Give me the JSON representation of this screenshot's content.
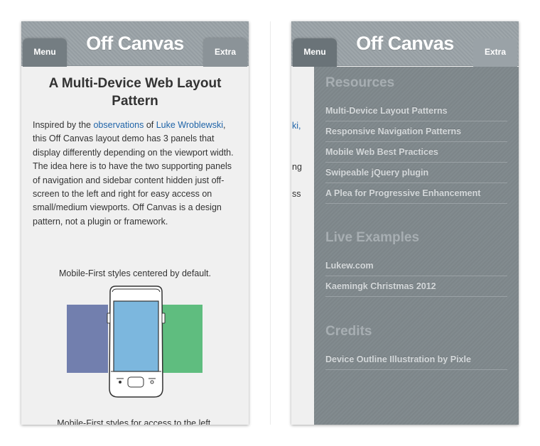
{
  "left_view": {
    "header": {
      "title": "Off Canvas",
      "menu_tab": "Menu",
      "extra_tab": "Extra"
    },
    "heading": "A Multi-Device Web Layout Pattern",
    "intro": {
      "p1": "Inspired by the ",
      "link1": "observations",
      "p2": " of ",
      "link2": "Luke Wroblewski",
      "p3": ", this Off Canvas layout demo has 3 panels that display differently depending on the viewport width. The idea here is to have the two supporting panels of navigation and sidebar content hidden just off-screen to the left and right for easy access on small/medium viewports. Off Canvas is a design pattern, not a plugin or framework."
    },
    "caption_1": "Mobile-First styles centered by default.",
    "caption_2": "Mobile-First styles for access to the left.",
    "colors": {
      "left_panel": "#727fae",
      "center_panel": "#7cb7de",
      "right_panel": "#5fbd7f",
      "link": "#1f64a8"
    }
  },
  "right_view": {
    "header": {
      "title": "Off Canvas",
      "menu_tab": "Menu",
      "extra_tab": "Extra"
    },
    "peek_lines": [
      "ki,",
      "ng",
      "ss"
    ],
    "sections": [
      {
        "title": "Resources",
        "items": [
          "Multi-Device Layout Patterns",
          "Responsive Navigation Patterns",
          "Mobile Web Best Practices",
          "Swipeable jQuery plugin",
          "A Plea for Progressive Enhancement"
        ]
      },
      {
        "title": "Live Examples",
        "items": [
          "Lukew.com",
          "Kaemingk Christmas 2012"
        ]
      },
      {
        "title": "Credits",
        "items": [
          "Device Outline Illustration by Pixle"
        ]
      }
    ]
  }
}
